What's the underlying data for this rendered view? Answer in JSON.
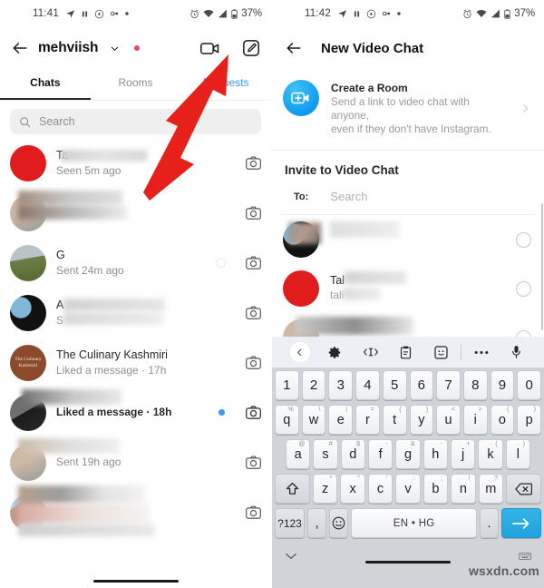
{
  "left_screen": {
    "status_bar": {
      "time": "11:41",
      "battery": "37%",
      "icons": [
        "send-icon",
        "pause-icon",
        "play-circle-icon",
        "link-icon",
        "dot-icon",
        "alarm-icon",
        "wifi-icon",
        "signal-icon",
        "battery-icon"
      ]
    },
    "header": {
      "back_icon": "back-arrow-icon",
      "username": "mehviish",
      "chevron_icon": "chevron-down-icon",
      "status_dot_color": "#ed4956",
      "video_icon": "video-camera-icon",
      "compose_icon": "compose-icon"
    },
    "tabs": [
      {
        "label": "Chats",
        "state": "active"
      },
      {
        "label": "Rooms",
        "state": "inactive"
      },
      {
        "label": "Requests",
        "state": "link"
      }
    ],
    "search": {
      "placeholder": "Search",
      "icon": "search-icon"
    },
    "chats": [
      {
        "name": "Ta",
        "sub": "Seen 5m ago",
        "avatar": "av-red",
        "redacted_name": true,
        "bold": false,
        "unread": false,
        "pending": false
      },
      {
        "name": "",
        "sub": "",
        "avatar": "av-beige",
        "redacted_name": true,
        "redacted_sub": true,
        "bold": false,
        "unread": false,
        "pending": false
      },
      {
        "name": "G",
        "sub": "Sent 24m ago",
        "avatar": "av-green",
        "redacted_name": false,
        "bold": false,
        "unread": false,
        "pending": true
      },
      {
        "name": "A",
        "sub": "S",
        "avatar": "av-bird",
        "redacted_name": true,
        "redacted_sub": true,
        "bold": false,
        "unread": false,
        "pending": false
      },
      {
        "name": "The Culinary Kashmiri",
        "sub": "Liked a message · 17h",
        "avatar": "av-brown",
        "avatar_text": "The Culinary Kashmiri",
        "redacted_name": false,
        "bold": false,
        "unread": false,
        "pending": false
      },
      {
        "name": "",
        "sub": "Liked a message · 18h",
        "avatar": "av-dark",
        "redacted_name": true,
        "bold": true,
        "unread": true,
        "pending": false
      },
      {
        "name": "",
        "sub": "Sent 19h ago",
        "avatar": "av-beige",
        "redacted_name": true,
        "bold": false,
        "unread": false,
        "pending": false
      },
      {
        "name": "",
        "sub": "",
        "avatar": "av-mix",
        "redacted_name": true,
        "redacted_sub": true,
        "bold": false,
        "unread": false,
        "pending": false
      }
    ],
    "annotation": {
      "shape": "red-arrow",
      "points_to": "video-camera-icon",
      "color": "#e8201c"
    },
    "camera_icon": "camera-icon"
  },
  "right_screen": {
    "status_bar": {
      "time": "11:42",
      "battery": "37%"
    },
    "header": {
      "back_icon": "back-arrow-icon",
      "title": "New Video Chat"
    },
    "create_room": {
      "icon": "video-plus-icon",
      "title": "Create a Room",
      "subtitle_line1": "Send a link to video chat with anyone,",
      "subtitle_line2": "even if they don't have Instagram.",
      "chevron": "chevron-right-icon"
    },
    "invite": {
      "section_title": "Invite to Video Chat",
      "to_label": "To:",
      "search_placeholder": "Search"
    },
    "contacts": [
      {
        "name": "",
        "handle": "",
        "avatar": "av-bird",
        "redacted": true,
        "selected": false
      },
      {
        "name": "Tal",
        "handle": "tali",
        "avatar": "av-red",
        "redacted": true,
        "selected": false
      },
      {
        "name": "",
        "handle": "",
        "avatar": "av-beige",
        "redacted": true,
        "selected": false
      }
    ],
    "keyboard": {
      "toolbar_icons": [
        "chevron-left-icon",
        "gear-icon",
        "cursor-control-icon",
        "clipboard-icon",
        "sticker-icon",
        "more-icon",
        "microphone-icon"
      ],
      "number_row": [
        "1",
        "2",
        "3",
        "4",
        "5",
        "6",
        "7",
        "8",
        "9",
        "0"
      ],
      "row1": [
        {
          "k": "q",
          "s": "%"
        },
        {
          "k": "w",
          "s": "\\"
        },
        {
          "k": "e",
          "s": "|"
        },
        {
          "k": "r",
          "s": "="
        },
        {
          "k": "t",
          "s": "{"
        },
        {
          "k": "y",
          "s": "}"
        },
        {
          "k": "u",
          "s": "<"
        },
        {
          "k": "i",
          "s": ">"
        },
        {
          "k": "o",
          "s": "("
        },
        {
          "k": "p",
          "s": ")"
        }
      ],
      "row2": [
        {
          "k": "a",
          "s": "@"
        },
        {
          "k": "s",
          "s": "#"
        },
        {
          "k": "d",
          "s": "$"
        },
        {
          "k": "f",
          "s": "-"
        },
        {
          "k": "g",
          "s": "&"
        },
        {
          "k": "h",
          "s": "-"
        },
        {
          "k": "j",
          "s": "+"
        },
        {
          "k": "k",
          "s": "("
        },
        {
          "k": "l",
          "s": ")"
        }
      ],
      "row3": [
        {
          "k": "z",
          "s": "*"
        },
        {
          "k": "x",
          "s": "\""
        },
        {
          "k": "c",
          "s": "'"
        },
        {
          "k": "v",
          "s": ":"
        },
        {
          "k": "b",
          "s": ";"
        },
        {
          "k": "n",
          "s": "!"
        },
        {
          "k": "m",
          "s": "?"
        }
      ],
      "shift_icon": "shift-icon",
      "backspace_icon": "backspace-icon",
      "symbols_key": "?123",
      "comma_key": ",",
      "emoji_key": "emoji-icon",
      "space_key": "EN • HG",
      "period_key": ".",
      "enter_icon": "enter-arrow-icon",
      "hide_keyboard_icon": "chevron-down-icon",
      "switch_keyboard_icon": "keyboard-icon",
      "accent_color": "#21a3dd"
    }
  },
  "watermark": "wsxdn.com"
}
